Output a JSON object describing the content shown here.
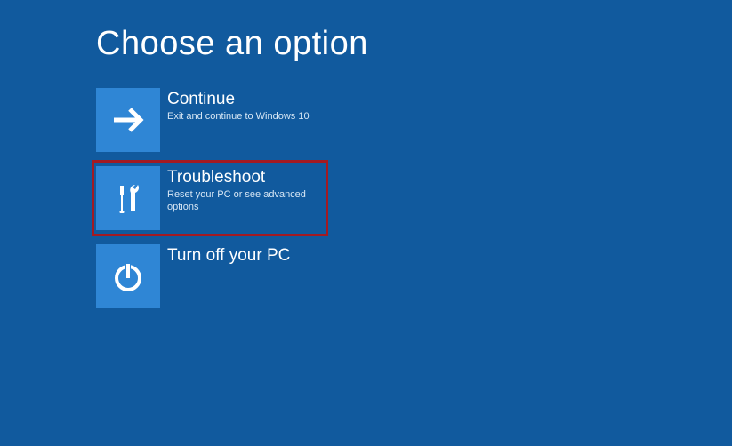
{
  "header": {
    "title": "Choose an option"
  },
  "options": {
    "continue": {
      "label": "Continue",
      "description": "Exit and continue to Windows 10"
    },
    "troubleshoot": {
      "label": "Troubleshoot",
      "description": "Reset your PC or see advanced options"
    },
    "turnoff": {
      "label": "Turn off your PC",
      "description": ""
    }
  },
  "colors": {
    "background": "#115a9e",
    "tile": "#2f86d5",
    "highlight_outline": "#a31a22"
  }
}
